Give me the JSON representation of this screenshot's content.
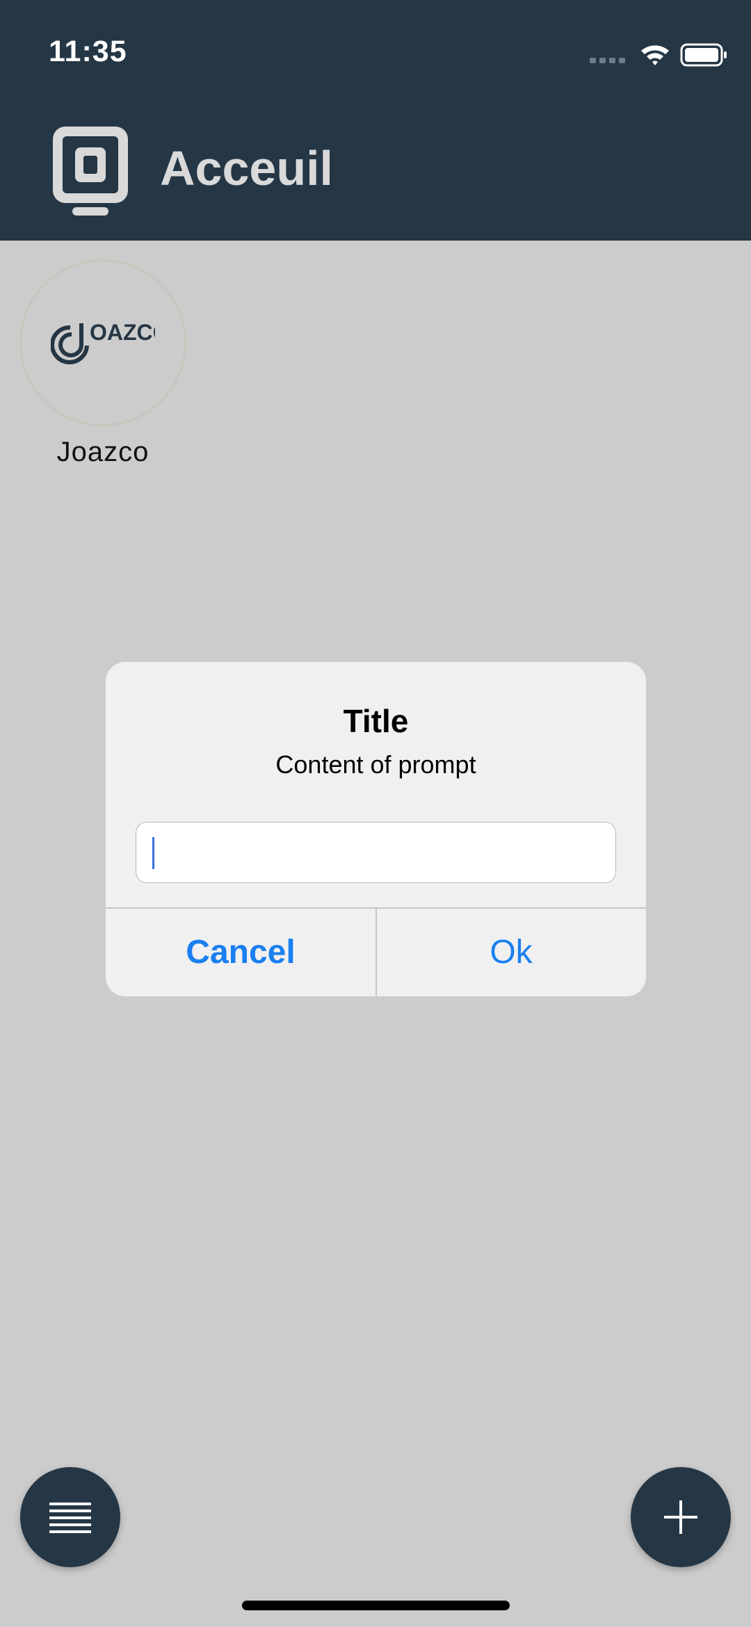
{
  "status_bar": {
    "time": "11:35",
    "icons": [
      "signal-icon",
      "wifi-icon",
      "battery-icon"
    ]
  },
  "header": {
    "logo_icon": "app-logo-icon",
    "logo_letter": "O",
    "title": "Acceuil"
  },
  "contacts": [
    {
      "name": "Joazco",
      "logo_text": "OAZCO",
      "icon": "joazco-logo-icon"
    }
  ],
  "dialog": {
    "title": "Title",
    "message": "Content of prompt",
    "input_value": "",
    "cancel_label": "Cancel",
    "ok_label": "Ok"
  },
  "fabs": {
    "menu_icon": "menu-icon",
    "add_icon": "add-icon"
  },
  "colors": {
    "header_bg": "#253645",
    "overlay_bg": "#cccccc",
    "dialog_bg": "#f0f0f0",
    "accent_blue": "#1a7ff0"
  }
}
